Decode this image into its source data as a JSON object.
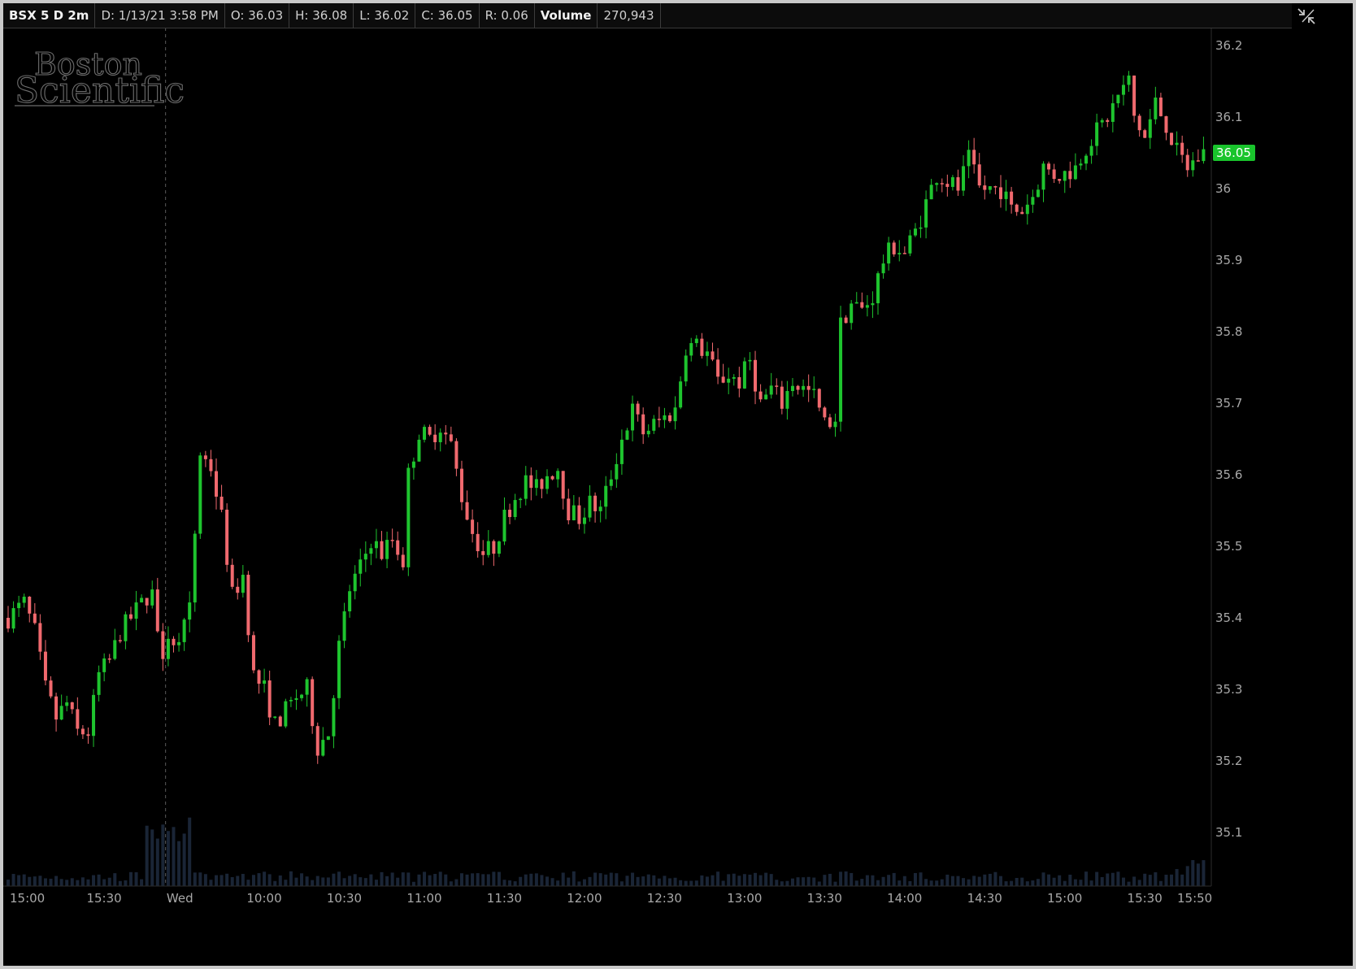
{
  "info_bar": {
    "symbol": "BSX 5 D 2m",
    "date": "D: 1/13/21 3:58 PM",
    "open": "O: 36.03",
    "high": "H: 36.08",
    "low": "L: 36.02",
    "close": "C: 36.05",
    "range": "R: 0.06",
    "volume_label": "Volume",
    "volume_value": "270,943"
  },
  "watermark": {
    "line1": "Boston",
    "line2": "Scientific"
  },
  "colors": {
    "up": "#1ec42e",
    "down": "#f0696e",
    "volume": "#1a2536",
    "bg": "#000000",
    "last_price_bg": "#19c42c"
  },
  "corner_icon": "collapse-arrows-icon",
  "chart_data": {
    "type": "candlestick",
    "interval": "2m",
    "ylim": [
      35.025,
      36.225
    ],
    "yticks": [
      "36.2",
      "36.1",
      "36",
      "35.9",
      "35.8",
      "35.7",
      "35.6",
      "35.5",
      "35.4",
      "35.3",
      "35.2",
      "35.1"
    ],
    "xtick_labels": [
      "15:00",
      "15:30",
      "Wed",
      "10:00",
      "10:30",
      "11:00",
      "11:30",
      "12:00",
      "12:30",
      "13:00",
      "13:30",
      "14:00",
      "14:30",
      "15:00",
      "15:30",
      "15:50"
    ],
    "session_divider_label": "Wed",
    "last_price": "36.05",
    "close_path": [
      [
        "15:00",
        35.4
      ],
      [
        "15:06",
        35.42
      ],
      [
        "15:10",
        35.38
      ],
      [
        "15:14",
        35.3
      ],
      [
        "15:18",
        35.26
      ],
      [
        "15:22",
        35.28
      ],
      [
        "15:26",
        35.24
      ],
      [
        "15:30",
        35.24
      ],
      [
        "15:34",
        35.32
      ],
      [
        "15:38",
        35.34
      ],
      [
        "15:42",
        35.38
      ],
      [
        "15:46",
        35.4
      ],
      [
        "15:50",
        35.42
      ],
      [
        "15:54",
        35.44
      ],
      [
        "15:58",
        35.33
      ],
      [
        "9:30",
        35.38
      ],
      [
        "9:34",
        35.36
      ],
      [
        "9:38",
        35.41
      ],
      [
        "9:42",
        35.63
      ],
      [
        "9:46",
        35.61
      ],
      [
        "9:50",
        35.54
      ],
      [
        "9:54",
        35.43
      ],
      [
        "9:58",
        35.46
      ],
      [
        "10:02",
        35.32
      ],
      [
        "10:06",
        35.3
      ],
      [
        "10:10",
        35.25
      ],
      [
        "10:14",
        35.27
      ],
      [
        "10:18",
        35.29
      ],
      [
        "10:22",
        35.3
      ],
      [
        "10:26",
        35.22
      ],
      [
        "10:30",
        35.24
      ],
      [
        "10:34",
        35.36
      ],
      [
        "10:38",
        35.44
      ],
      [
        "10:42",
        35.47
      ],
      [
        "10:46",
        35.51
      ],
      [
        "10:50",
        35.49
      ],
      [
        "10:54",
        35.51
      ],
      [
        "10:58",
        35.48
      ],
      [
        "11:00",
        35.6
      ],
      [
        "11:04",
        35.66
      ],
      [
        "11:08",
        35.65
      ],
      [
        "11:12",
        35.67
      ],
      [
        "11:16",
        35.64
      ],
      [
        "11:20",
        35.57
      ],
      [
        "11:24",
        35.52
      ],
      [
        "11:28",
        35.49
      ],
      [
        "11:32",
        35.5
      ],
      [
        "11:36",
        35.54
      ],
      [
        "11:40",
        35.57
      ],
      [
        "11:44",
        35.59
      ],
      [
        "11:48",
        35.58
      ],
      [
        "11:52",
        35.6
      ],
      [
        "11:56",
        35.61
      ],
      [
        "12:00",
        35.55
      ],
      [
        "12:04",
        35.54
      ],
      [
        "12:08",
        35.56
      ],
      [
        "12:12",
        35.55
      ],
      [
        "12:16",
        35.6
      ],
      [
        "12:20",
        35.65
      ],
      [
        "12:24",
        35.69
      ],
      [
        "12:28",
        35.66
      ],
      [
        "12:32",
        35.67
      ],
      [
        "12:36",
        35.68
      ],
      [
        "12:40",
        35.69
      ],
      [
        "12:44",
        35.78
      ],
      [
        "12:48",
        35.78
      ],
      [
        "12:52",
        35.77
      ],
      [
        "12:56",
        35.73
      ],
      [
        "13:00",
        35.74
      ],
      [
        "13:04",
        35.73
      ],
      [
        "13:08",
        35.76
      ],
      [
        "13:12",
        35.7
      ],
      [
        "13:16",
        35.72
      ],
      [
        "13:20",
        35.7
      ],
      [
        "13:24",
        35.73
      ],
      [
        "13:28",
        35.72
      ],
      [
        "13:32",
        35.71
      ],
      [
        "13:36",
        35.67
      ],
      [
        "13:40",
        35.68
      ],
      [
        "13:42",
        35.81
      ],
      [
        "13:46",
        35.84
      ],
      [
        "13:50",
        35.83
      ],
      [
        "13:54",
        35.85
      ],
      [
        "13:58",
        35.9
      ],
      [
        "14:02",
        35.92
      ],
      [
        "14:06",
        35.91
      ],
      [
        "14:10",
        35.94
      ],
      [
        "14:14",
        35.98
      ],
      [
        "14:18",
        36.02
      ],
      [
        "14:22",
        36.01
      ],
      [
        "14:26",
        36.0
      ],
      [
        "14:30",
        36.04
      ],
      [
        "14:34",
        36.0
      ],
      [
        "14:38",
        36.0
      ],
      [
        "14:42",
        36.0
      ],
      [
        "14:46",
        35.97
      ],
      [
        "14:50",
        35.97
      ],
      [
        "14:54",
        35.99
      ],
      [
        "14:58",
        36.03
      ],
      [
        "15:02",
        36.02
      ],
      [
        "15:06",
        36.02
      ],
      [
        "15:10",
        36.03
      ],
      [
        "15:14",
        36.06
      ],
      [
        "15:18",
        36.08
      ],
      [
        "15:22",
        36.1
      ],
      [
        "15:26",
        36.13
      ],
      [
        "15:30",
        36.15
      ],
      [
        "15:32",
        36.1
      ],
      [
        "15:36",
        36.07
      ],
      [
        "15:40",
        36.12
      ],
      [
        "15:44",
        36.09
      ],
      [
        "15:48",
        36.05
      ],
      [
        "15:52",
        36.03
      ],
      [
        "15:58",
        36.05
      ]
    ]
  }
}
